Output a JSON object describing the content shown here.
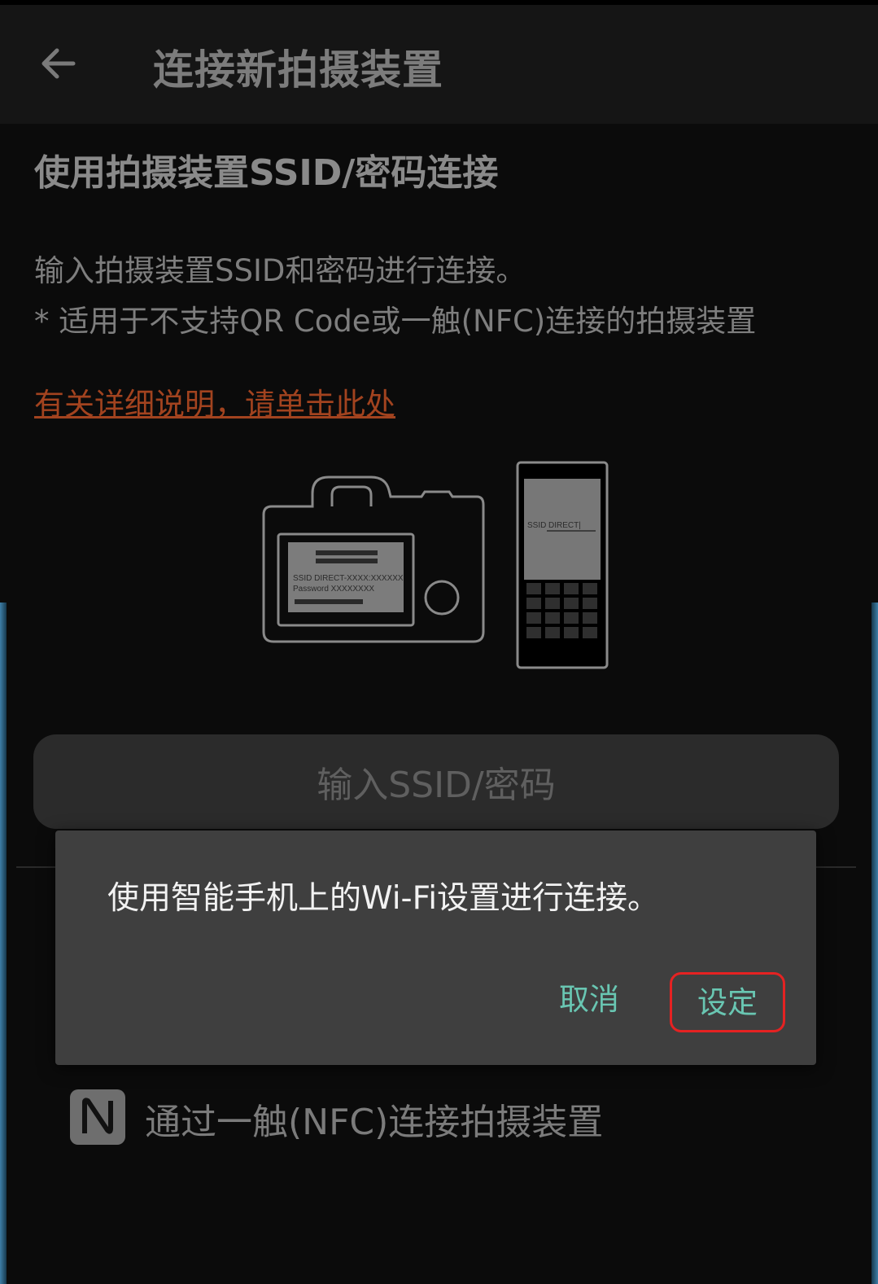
{
  "app_bar": {
    "title": "连接新拍摄装置",
    "back_icon": "arrow-left-icon"
  },
  "section": {
    "title": "使用拍摄装置SSID/密码连接",
    "desc_line1": "输入拍摄装置SSID和密码进行连接。",
    "desc_line2": "* 适用于不支持QR Code或一触(NFC)连接的拍摄装置",
    "help_link": "有关详细说明，请单击此处"
  },
  "illustration": {
    "camera_ssid": "SSID DIRECT-XXXX:XXXXXX",
    "camera_password": "Password XXXXXXXX",
    "phone_ssid_label": "SSID",
    "phone_ssid_value": "DIRECT|"
  },
  "primary_button": {
    "label": "输入SSID/密码"
  },
  "nfc": {
    "icon": "nfc-icon",
    "label": "通过一触(NFC)连接拍摄装置"
  },
  "dialog": {
    "message": "使用智能手机上的Wi-Fi设置进行连接。",
    "cancel_label": "取消",
    "ok_label": "设定"
  },
  "colors": {
    "background": "#0b0b0b",
    "app_bar": "#151515",
    "dialog": "#3f3f3f",
    "accent_teal": "#69c6b2",
    "link_orange": "#a2431f",
    "highlight_red": "#e52222",
    "edge_glow": "#3e7fa8"
  }
}
